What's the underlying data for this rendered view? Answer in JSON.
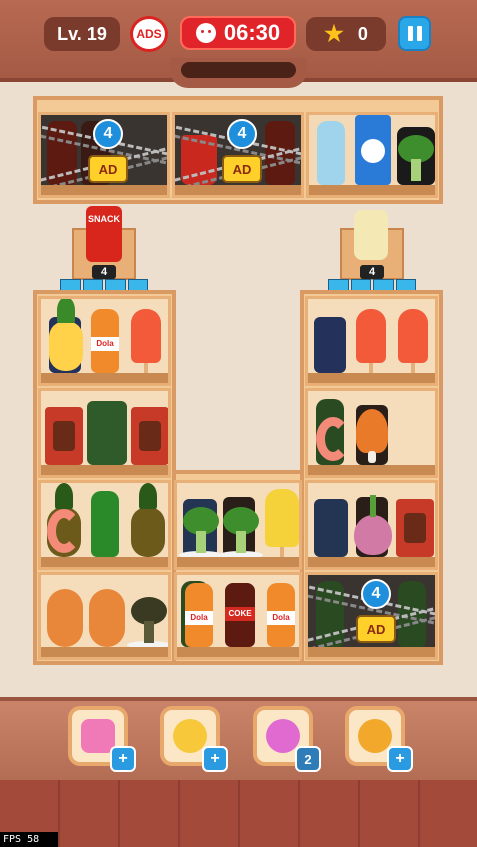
{
  "hud": {
    "level": "Lv. 19",
    "ads_label": "ADS",
    "timer": "06:30",
    "stars": "0"
  },
  "locks": {
    "shelf1_count": "4",
    "shelf2_count": "4",
    "bottom_count": "4",
    "ad_label": "AD"
  },
  "items": {
    "snack_label": "SNACK",
    "dola_label": "Dola",
    "coke_label": "COKE"
  },
  "stacks": {
    "left_count": "4",
    "right_count": "4"
  },
  "boosters": {
    "magnet_badge": "2"
  },
  "debug": {
    "fps": "FPS  58"
  },
  "colors": {
    "accent": "#2aa7e8",
    "timer_red": "#e0242a",
    "shelf_wood": "#f3c996"
  },
  "icons": [
    "skull-icon",
    "star-icon",
    "pause-icon",
    "hammer-icon",
    "magic-wand-icon",
    "magnet-icon",
    "shuffle-icon",
    "lock-icon",
    "plus-icon"
  ]
}
